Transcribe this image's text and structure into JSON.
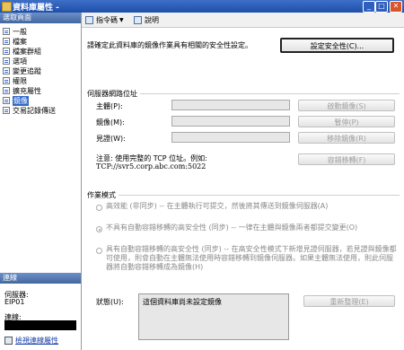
{
  "window": {
    "title": "資料庫屬性 -"
  },
  "left": {
    "select_page_header": "選取頁面",
    "items": [
      {
        "label": "一般"
      },
      {
        "label": "檔案"
      },
      {
        "label": "檔案群組"
      },
      {
        "label": "選項"
      },
      {
        "label": "變更追蹤"
      },
      {
        "label": "權限"
      },
      {
        "label": "擴充屬性"
      },
      {
        "label": "鏡像"
      },
      {
        "label": "交易記錄傳送"
      }
    ],
    "connection_header": "連線",
    "server_label": "伺服器:",
    "server_value": "EIP01",
    "connection_label": "連線:",
    "view_connection_properties": "檢視連線屬性"
  },
  "toolbar": {
    "script_label": "指令碼",
    "help_label": "說明"
  },
  "main": {
    "intro_text": "請確定此資料庫的鏡像作業具有相關的安全性設定。",
    "configure_security_button": "設定安全性(C)...",
    "server_addresses_group": "伺服器網路位址",
    "principal_label": "主體(P):",
    "mirror_label": "鏡像(M):",
    "witness_label": "見證(W):",
    "start_mirroring_button": "啟動鏡像(S)",
    "pause_button": "暫停(P)",
    "remove_mirroring_button": "移除鏡像(R)",
    "failover_button": "容錯移轉(F)",
    "note_line1": "注意: 使用完整的 TCP 位址。例如:",
    "note_line2": "TCP://svr5.corp.abc.com:5022",
    "operating_mode_group": "作業模式",
    "mode_high_performance": "高效能 (非同步) -- 在主體執行可提交，然後將其傳送到鏡像伺服器(A)",
    "mode_high_safety": "不具有自動容錯移轉的高安全性 (同步) -- 一律在主體與鏡像兩者都提交變更(O)",
    "mode_high_safety_auto": "具有自動容錯移轉的高安全性 (同步) -- 在高安全性模式下新增見證伺服器，若見證與鏡像都可使用，則會自動在主體無法使用時容錯移轉到鏡像伺服器。如果主體無法使用，則此伺服器將自動容錯移轉成為鏡像(H)",
    "status_label": "狀態(U):",
    "status_value": "這個資料庫尚未設定鏡像",
    "refresh_button": "重新整理(E)"
  }
}
